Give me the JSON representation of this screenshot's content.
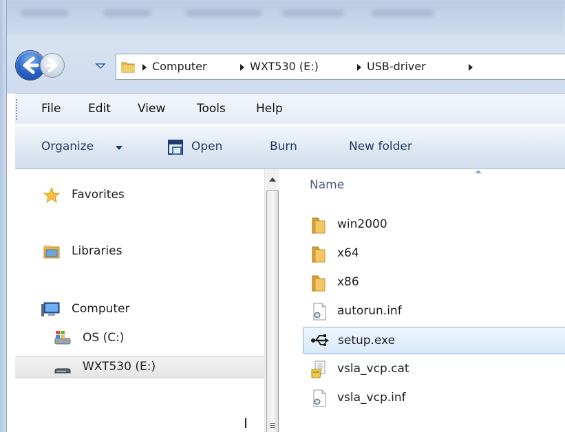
{
  "address_bar": {
    "crumbs": [
      "Computer",
      "WXT530 (E:)",
      "USB-driver"
    ]
  },
  "menu": {
    "items": [
      "File",
      "Edit",
      "View",
      "Tools",
      "Help"
    ]
  },
  "command_bar": {
    "organize": "Organize",
    "open": "Open",
    "burn": "Burn",
    "new_folder": "New folder"
  },
  "nav_pane": {
    "favorites": "Favorites",
    "libraries": "Libraries",
    "computer": "Computer",
    "drive_c": "OS (C:)",
    "drive_e": "WXT530 (E:)",
    "selected": "WXT530 (E:)"
  },
  "file_list": {
    "column_name": "Name",
    "items": [
      {
        "name": "win2000",
        "icon": "folder-icon"
      },
      {
        "name": "x64",
        "icon": "folder-icon"
      },
      {
        "name": "x86",
        "icon": "folder-icon"
      },
      {
        "name": "autorun.inf",
        "icon": "settings-file-icon"
      },
      {
        "name": "setup.exe",
        "icon": "usb-icon"
      },
      {
        "name": "vsla_vcp.cat",
        "icon": "catalog-file-icon"
      },
      {
        "name": "vsla_vcp.inf",
        "icon": "settings-file-icon"
      }
    ],
    "selected": "setup.exe"
  },
  "colors": {
    "frame": "#d7e3f2",
    "selection": "#d9e9fb",
    "selection_border": "#84acdd",
    "folder": "#e8b64a"
  }
}
